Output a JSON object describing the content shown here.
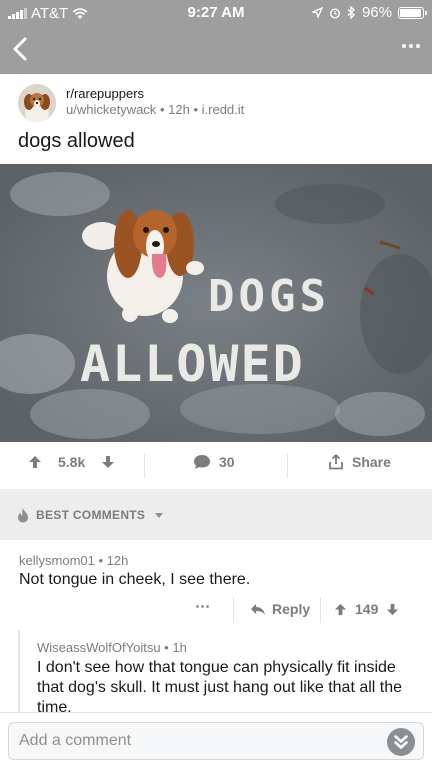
{
  "status_bar": {
    "carrier": "AT&T",
    "time": "9:27 AM",
    "battery": "96%",
    "battery_level": 0.96
  },
  "post": {
    "subreddit": "r/rarepuppers",
    "author": "u/whicketywack",
    "age": "12h",
    "domain": "i.redd.it",
    "meta_separator": "•",
    "title": "dogs allowed",
    "image_text_line1": "DOGS",
    "image_text_line2": "ALLOWED"
  },
  "actions": {
    "score": "5.8k",
    "comments": "30",
    "share_label": "Share"
  },
  "sort": {
    "label": "BEST COMMENTS"
  },
  "comments": [
    {
      "author": "kellysmom01",
      "age": "12h",
      "body": "Not tongue in cheek, I see there.",
      "reply_label": "Reply",
      "score": "149"
    },
    {
      "author": "WiseassWolfOfYoitsu",
      "age": "1h",
      "body": "I don't see how that tongue can physically fit inside that dog's skull. It must just hang out like that all the time."
    }
  ],
  "composer": {
    "placeholder": "Add a comment"
  },
  "colors": {
    "chrome": "#9e9e9e",
    "muted_text": "#7c7c7c",
    "separator_bar": "#ededed"
  }
}
